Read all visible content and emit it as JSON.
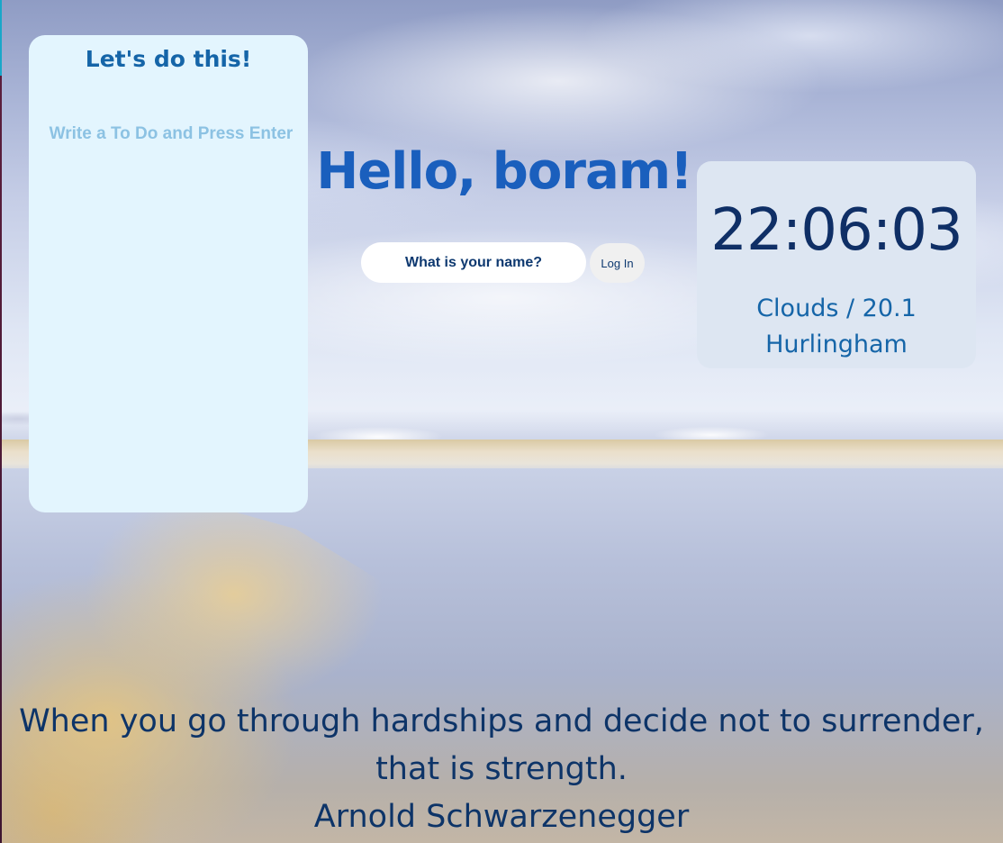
{
  "todo": {
    "title": "Let's do this!",
    "input_placeholder": "Write a To Do and Press Enter",
    "items": []
  },
  "greeting": {
    "text": "Hello, boram!"
  },
  "login": {
    "name_placeholder": "What is your name?",
    "button_label": "Log In"
  },
  "clock": {
    "time": "22:06:03"
  },
  "weather": {
    "description": "Clouds / 20.1",
    "city": "Hurlingham"
  },
  "quote": {
    "text": "When you go through hardships and decide not to surrender, that is strength.",
    "author": "Arnold Schwarzenegger"
  },
  "colors": {
    "todo_panel_bg": "#e3f5fe",
    "greeting": "#1a5fbd",
    "clock_card_bg": "#dde6f2",
    "quote": "#0d3468"
  }
}
